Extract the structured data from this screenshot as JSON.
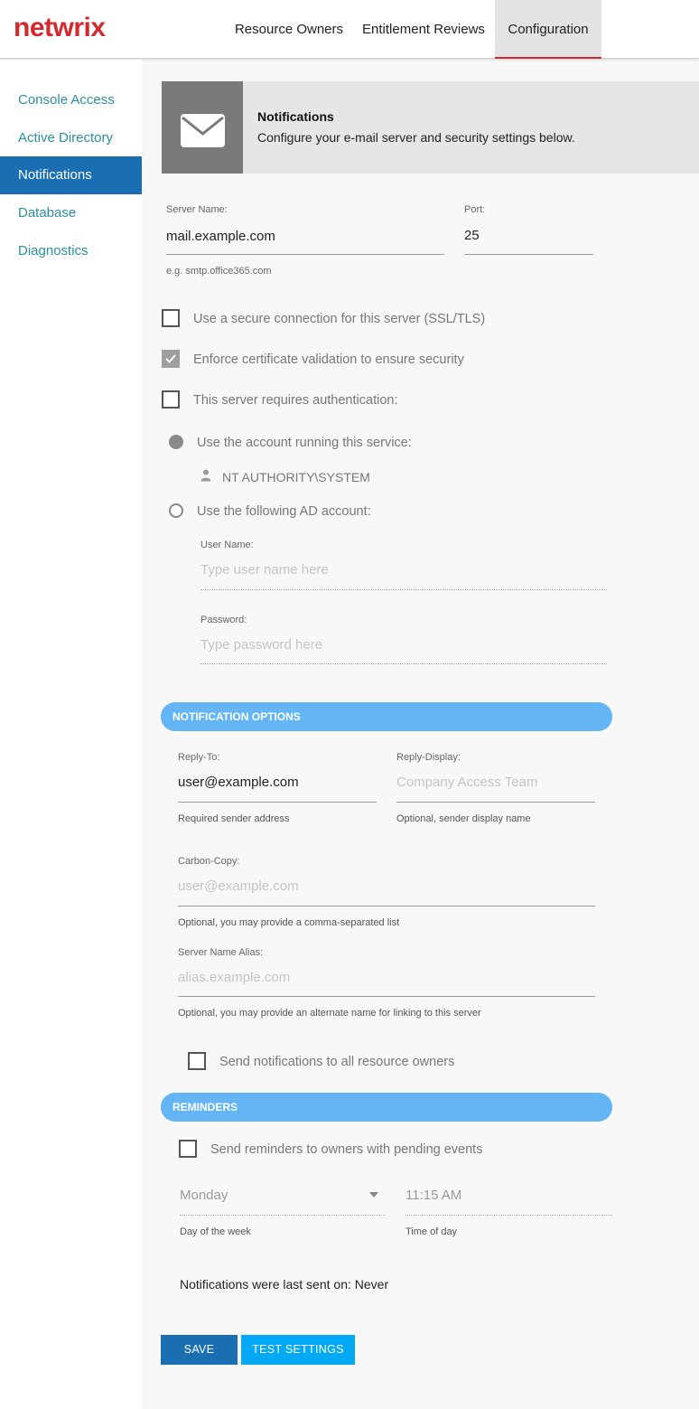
{
  "brand": {
    "logo_text": "netwrix",
    "logo_color": "#d42a2f"
  },
  "nav": {
    "tabs": [
      {
        "label": "Resource Owners"
      },
      {
        "label": "Entitlement Reviews"
      },
      {
        "label": "Configuration",
        "active": true
      }
    ]
  },
  "sidebar": {
    "items": [
      {
        "label": "Console Access"
      },
      {
        "label": "Active Directory"
      },
      {
        "label": "Notifications",
        "active": true
      },
      {
        "label": "Database"
      },
      {
        "label": "Diagnostics"
      }
    ]
  },
  "banner": {
    "icon": "envelope-icon",
    "title": "Notifications",
    "subtitle": "Configure your e-mail server and security settings below."
  },
  "server": {
    "name_label": "Server Name:",
    "name_value": "mail.example.com",
    "name_hint": "e.g. smtp.office365.com",
    "port_label": "Port:",
    "port_value": "25"
  },
  "options": {
    "ssl_label": "Use a secure connection for this server (SSL/TLS)",
    "ssl_checked": false,
    "cert_label": "Enforce certificate validation to ensure security",
    "cert_checked": true,
    "auth_label": "This server requires authentication:",
    "auth_checked": false
  },
  "auth": {
    "service_account_label": "Use the account running this service:",
    "service_account_selected": true,
    "service_account_name": "NT AUTHORITY\\SYSTEM",
    "ad_account_label": "Use the following AD account:",
    "ad_account_selected": false,
    "username_label": "User Name:",
    "username_placeholder": "Type user name here",
    "password_label": "Password:",
    "password_placeholder": "Type password here"
  },
  "notification_options": {
    "section_title": "NOTIFICATION OPTIONS",
    "reply_to_label": "Reply-To:",
    "reply_to_value": "user@example.com",
    "reply_to_hint": "Required sender address",
    "reply_display_label": "Reply-Display:",
    "reply_display_placeholder": "Company Access Team",
    "reply_display_hint": "Optional, sender display name",
    "cc_label": "Carbon-Copy:",
    "cc_placeholder": "user@example.com",
    "cc_hint": "Optional, you may provide a comma-separated list",
    "alias_label": "Server Name Alias:",
    "alias_placeholder": "alias.example.com",
    "alias_hint": "Optional, you may provide an alternate name for linking to this server",
    "send_all_label": "Send notifications to all resource owners",
    "send_all_checked": false
  },
  "reminders": {
    "section_title": "REMINDERS",
    "send_label": "Send reminders to owners with pending events",
    "send_checked": false,
    "day_value": "Monday",
    "day_hint": "Day of the week",
    "time_value": "11:15 AM",
    "time_hint": "Time of day",
    "last_sent_text": "Notifications were last sent on: Never"
  },
  "actions": {
    "save_label": "SAVE",
    "test_label": "TEST SETTINGS"
  },
  "colors": {
    "accent_blue": "#1a6fb3",
    "section_blue": "#64b5f6",
    "test_button": "#03a9f4",
    "link_teal": "#2a8fa0"
  }
}
